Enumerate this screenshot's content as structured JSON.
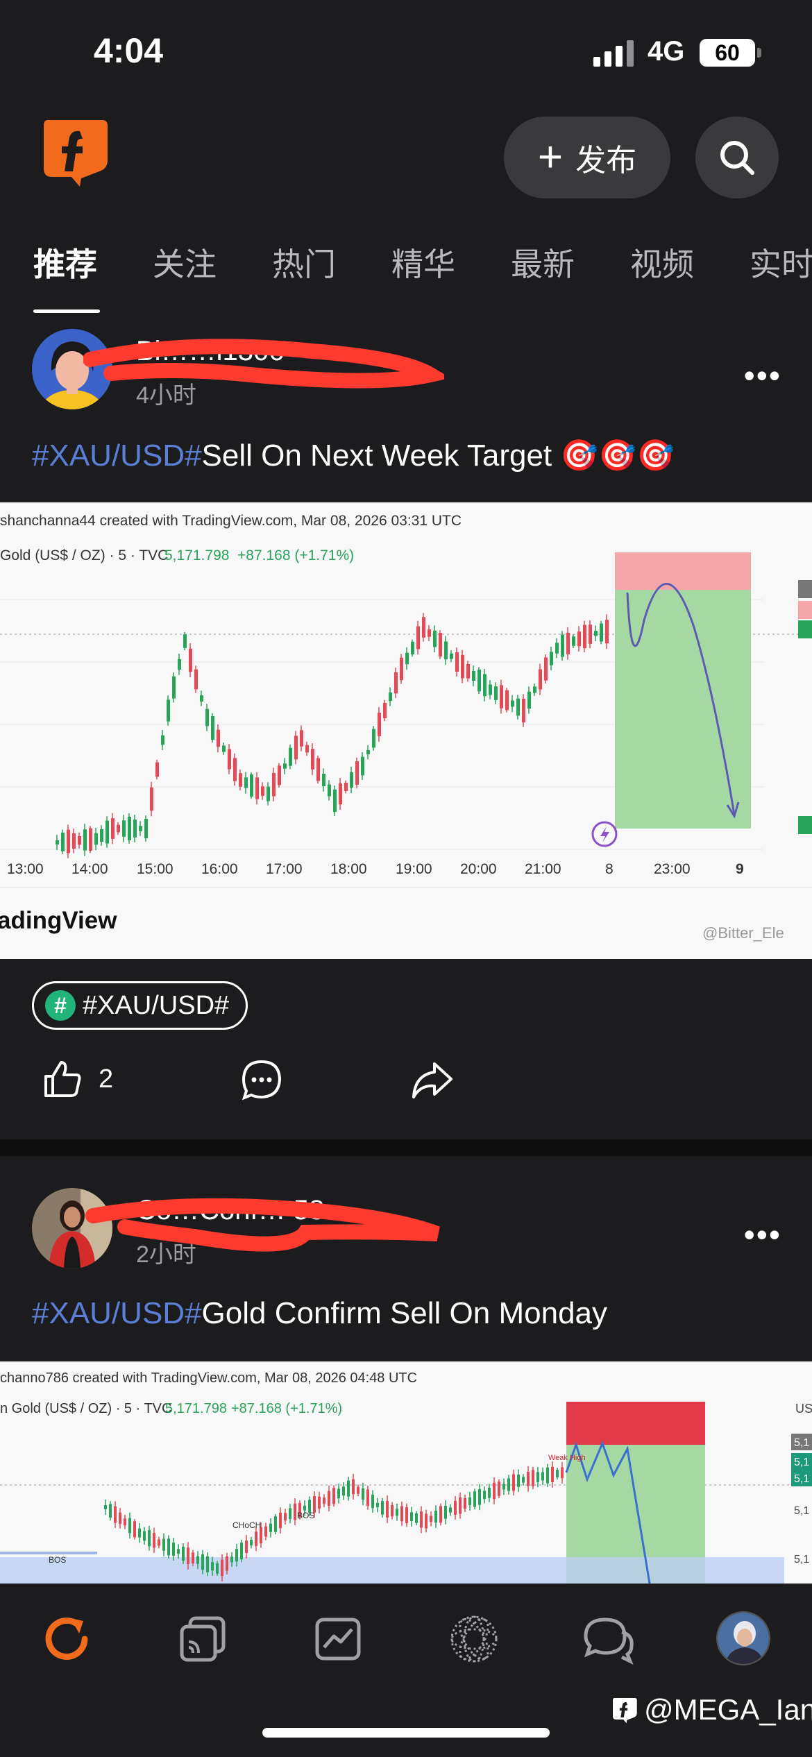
{
  "status_bar": {
    "time": "4:04",
    "network": "4G",
    "battery": "60"
  },
  "header": {
    "post_label": "发布",
    "logo_icon": "f-logo-icon",
    "search_icon": "search-icon"
  },
  "tabs": [
    {
      "label": "推荐",
      "active": true
    },
    {
      "label": "关注"
    },
    {
      "label": "热门"
    },
    {
      "label": "精华"
    },
    {
      "label": "最新"
    },
    {
      "label": "视频"
    },
    {
      "label": "实时"
    }
  ],
  "posts": [
    {
      "username": "Bi……l1306",
      "time": "4小时",
      "title_tag": "#XAU/USD#",
      "title_text": "Sell On Next Week Target 🎯🎯🎯",
      "chart": {
        "header": "shanchanna44 created with TradingView.com, Mar 08, 2026 03:31 UTC",
        "symbol": "Gold (US$ / OZ) · 5 · TVC",
        "price": "5,171.798",
        "change": "+87.168 (+1.71%)",
        "x_ticks": [
          "13:00",
          "14:00",
          "15:00",
          "16:00",
          "17:00",
          "18:00",
          "19:00",
          "20:00",
          "21:00",
          "8",
          "23:00",
          "9"
        ],
        "brand": "adingView",
        "credit": "@Bitter_Ele"
      },
      "topic": "#XAU/USD#",
      "likes": "2"
    },
    {
      "username": "Co…Conf… 58",
      "time": "2小时",
      "title_tag": "#XAU/USD#",
      "title_text": "Gold Confirm Sell On Monday",
      "chart": {
        "header": "channo786 created with TradingView.com, Mar 08, 2026 04:48 UTC",
        "symbol": "n Gold (US$ / OZ) · 5 · TVC",
        "price": "5,171.798",
        "change": "+87.168 (+1.71%)",
        "labels": [
          "BOS",
          "CHoCH",
          "BOS",
          "Weak High"
        ],
        "right_labels": [
          "US",
          "5,1",
          "5,1",
          "5,1",
          "5,1",
          "5,1"
        ]
      }
    }
  ],
  "bottom_nav": [
    {
      "name": "refresh",
      "icon": "refresh-icon",
      "active": true
    },
    {
      "name": "feeds",
      "icon": "cards-icon"
    },
    {
      "name": "markets",
      "icon": "chart-icon"
    },
    {
      "name": "discover",
      "icon": "sphere-icon"
    },
    {
      "name": "messages",
      "icon": "chat-icon"
    },
    {
      "name": "profile",
      "icon": "avatar-icon"
    }
  ],
  "watermark": "@MEGA_Ian",
  "colors": {
    "accent": "#f26b1d",
    "tag": "#5b7fd4",
    "green_candle": "#27a35a",
    "red_candle": "#e24a55"
  }
}
